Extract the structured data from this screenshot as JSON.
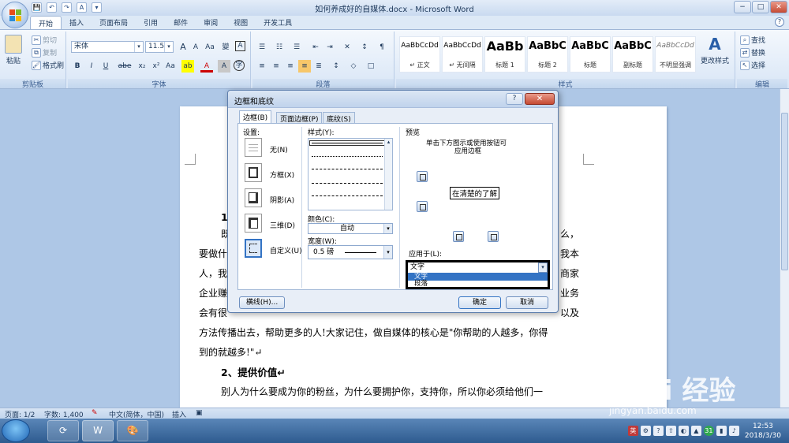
{
  "window": {
    "title": "如何养成好的自媒体.docx - Microsoft Word",
    "min": "−",
    "max": "□",
    "close": "✕"
  },
  "qat": [
    "💾",
    "↶",
    "↷",
    "A",
    "▾"
  ],
  "ribbon": {
    "tabs": [
      "开始",
      "插入",
      "页面布局",
      "引用",
      "邮件",
      "审阅",
      "视图",
      "开发工具"
    ],
    "clipboard": {
      "paste": "粘贴",
      "cut": "剪切",
      "copy": "复制",
      "format_painter": "格式刷",
      "label": "剪贴板"
    },
    "font": {
      "name": "宋体",
      "size": "11.5",
      "label": "字体",
      "bold": "B",
      "italic": "I",
      "underline": "U",
      "strike": "abe",
      "sub": "x₂",
      "sup": "x²",
      "clear": "Aa",
      "grow": "A",
      "shrink": "A",
      "wen": "變",
      "border": "A",
      "highlight": "ab",
      "color": "A",
      "shade": "A",
      "circle": "字"
    },
    "paragraph": {
      "label": "段落"
    },
    "styles": {
      "label": "样式",
      "items": [
        {
          "sample": "AaBbCcDd",
          "name": "↵ 正文"
        },
        {
          "sample": "AaBbCcDd",
          "name": "↵ 无间隔"
        },
        {
          "sample": "AaBb",
          "name": "标题 1"
        },
        {
          "sample": "AaBbC",
          "name": "标题 2"
        },
        {
          "sample": "AaBbC",
          "name": "标题"
        },
        {
          "sample": "AaBbC",
          "name": "副标题"
        },
        {
          "sample": "AaBbCcDd",
          "name": "不明显强调"
        }
      ],
      "change": "更改样式"
    },
    "editing": {
      "label": "编辑",
      "find": "查找",
      "replace": "替换",
      "select": "选择"
    }
  },
  "document": {
    "lines": [
      "1、",
      "既",
      "要做什",
      "人，我",
      "企业赚",
      "会有很",
      "方法传播出去，帮助更多的人!大家记住，做自媒体的核心是\"你帮助的人越多，你得",
      "到的就越多!\"↵",
      "2、提供价值↵",
      "别人为什么要成为你的粉丝，为什么要拥护你，支持你，所以你必须给他们一"
    ],
    "right_fragments": [
      "么，",
      "我本",
      "商家",
      "业务",
      "以及"
    ]
  },
  "dialog": {
    "title": "边框和底纹",
    "help": "?",
    "close": "✕",
    "tabs": [
      "边框(B)",
      "页面边框(P)",
      "底纹(S)"
    ],
    "setting_label": "设置:",
    "settings": [
      "无(N)",
      "方框(X)",
      "阴影(A)",
      "三维(D)",
      "自定义(U)"
    ],
    "style_label": "样式(Y):",
    "color_label": "颜色(C):",
    "color_value": "自动",
    "width_label": "宽度(W):",
    "width_value": "0.5 磅",
    "preview_label": "预览",
    "preview_hint_1": "单击下方图示或使用按钮可",
    "preview_hint_2": "应用边框",
    "preview_text": "在清楚的了解",
    "apply_label": "应用于(L):",
    "apply_value": "文字",
    "apply_options": [
      "文字",
      "段落"
    ],
    "hline_button": "横线(H)...",
    "ok": "确定",
    "cancel": "取消"
  },
  "status": {
    "page": "页面: 1/2",
    "words": "字数: 1,400",
    "lang": "中文(简体，中国)",
    "insert": "插入"
  },
  "taskbar": {
    "time": "12:53",
    "date": "2018/3/30",
    "ime": "英",
    "badge": "31"
  },
  "watermark": {
    "text": "Bai 经验",
    "url": "jingyan.baidu.com"
  }
}
